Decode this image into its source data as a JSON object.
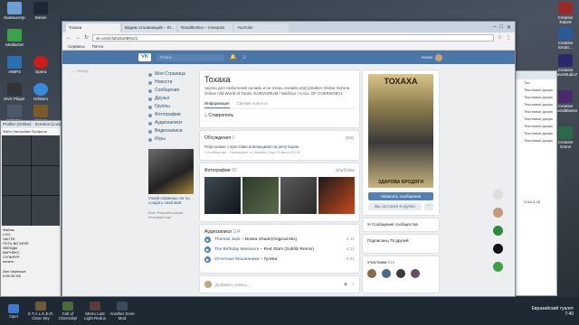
{
  "desktop": {
    "icons_left": [
      {
        "label": "Компьютер",
        "color": "#6d9ed6"
      },
      {
        "label": "MediaGet",
        "color": "#3da04a"
      },
      {
        "label": "AIMP3",
        "color": "#2a6fb0"
      },
      {
        "label": "DivX Player",
        "color": "#333333"
      },
      {
        "label": "FileMan",
        "color": "#4a5a6a"
      }
    ],
    "icons_col2": [
      {
        "label": "Steam",
        "color": "#1b2838"
      },
      {
        "label": "Opera",
        "color": "#cc1b1b"
      },
      {
        "label": "Orbitum",
        "color": "#3b8ad8"
      },
      {
        "label": "Heroes",
        "color": "#7a5a2a"
      }
    ],
    "icons_right": [
      {
        "label": "Creative Rake9",
        "color": "#9a2a2a"
      },
      {
        "label": "Creative Smart…",
        "color": "#2a5a9a"
      },
      {
        "label": "Creative WaveStudio7",
        "color": "#2a2a6a"
      },
      {
        "label": "Creative SoundBlaster",
        "color": "#4a2a6a"
      },
      {
        "label": "Creative Game",
        "color": "#2a6a4a"
      }
    ]
  },
  "side_window": {
    "title": "Profiler (Online) · Screens (Local)",
    "menu": "Файл  Настройки  Профиль",
    "list_label": "Файлы",
    "list_items": [
      "LOG",
      "ЧАСТИ",
      "ПУТЬ ВО МГЛЕ",
      "ЗВЕЗДЫ",
      "ВАРНЕКС",
      "СУЛЬФУР",
      "ничего"
    ],
    "footer": "Зап Черныше",
    "timer": "0:59:35.5/0"
  },
  "right_window": {
    "items": [
      "Тип",
      "Текстовый докум",
      "Текстовый докум",
      "Текстовый докум",
      "Текстовый докум",
      "Текстовый докум",
      "Текстовый докум",
      "Текстовый докум",
      "Текстовый докум"
    ],
    "date": "2016-6-28"
  },
  "browser": {
    "tabs": [
      "Тохаха",
      "Вадим отзывающий – Ю…",
      "Rand0luNoo – mosquito",
      "YouTube"
    ],
    "url": "vk.com/club151069121",
    "bookmarks": [
      "Сервисы",
      "Почта"
    ]
  },
  "vk": {
    "search_placeholder": "Поиск",
    "user_name": "Антон",
    "back_label": "Назад",
    "nav": [
      "Моя Страница",
      "Новости",
      "Сообщения",
      "Друзья",
      "Группы",
      "Фотографии",
      "Аудиозаписи",
      "Видеозаписи",
      "Игры"
    ],
    "ad_text": "Узнай сможешь ли ты создать свой Batt",
    "footer": "Блог  Разработчикам  Реклама  Ещё"
  },
  "group": {
    "title": "Тохаха",
    "description": "группа для любителей онлайн и не очень онлайн игр(с)Stalker Online /SZone Online Old World of Tanks /SURVARIUM / Warface / CALL OF CHERNOBYL",
    "tabs": [
      "Информация",
      "Свежие новости"
    ],
    "city": "Ставрополь",
    "discussions_title": "Обсуждения",
    "discussions_count": "1",
    "discussions_edit": "ред.",
    "topic": "Персонажи с крестами влияющими на репутацию",
    "topic_meta": "1 сообщение · Последнее от Vacellon Day 23 мин в 20:22",
    "photos_title": "Фотографии",
    "photos_count": "60",
    "photos_link": "альбомы",
    "audio_title": "Аудиозаписи",
    "audio_count": "104",
    "tracks": [
      {
        "artist": "Thomas Jack",
        "title": "Booka Shade(Original Mix)",
        "duration": "4:11"
      },
      {
        "artist": "The Birthday Massacre",
        "title": "Red Stars (Subfilz Remix)",
        "duration": "4:12"
      },
      {
        "artist": "Отчетные Мошенники",
        "title": "Гуляка",
        "duration": "3:21"
      }
    ],
    "post_placeholder": "Добавить запись…",
    "poster_title": "ТОХАХА",
    "poster_bottom": "ЗДАРОВА БРОДЯГИ",
    "msg_button": "Написать сообщение",
    "member_button": "Вы состоите в группе",
    "more_button": "···",
    "community_messages": "Сообщения сообщества",
    "subscribed": "Подписаны 76 друзей",
    "members_label": "Участники",
    "members_count": "615"
  },
  "taskbar": {
    "items": [
      {
        "label": "Opel",
        "color": "#3a7ad0"
      },
      {
        "label": "S.T.A.L.K.E.R. Clear Sky",
        "color": "#6a5a3a"
      },
      {
        "label": "Call of Chernobyl",
        "color": "#4a6a3a"
      },
      {
        "label": "Metro Last Light Redux",
        "color": "#5a3a3a"
      },
      {
        "label": "Another Zone Mod",
        "color": "#3a4a5a"
      }
    ],
    "clock_tray": "Евразийский туалет",
    "clock": "7:40"
  }
}
